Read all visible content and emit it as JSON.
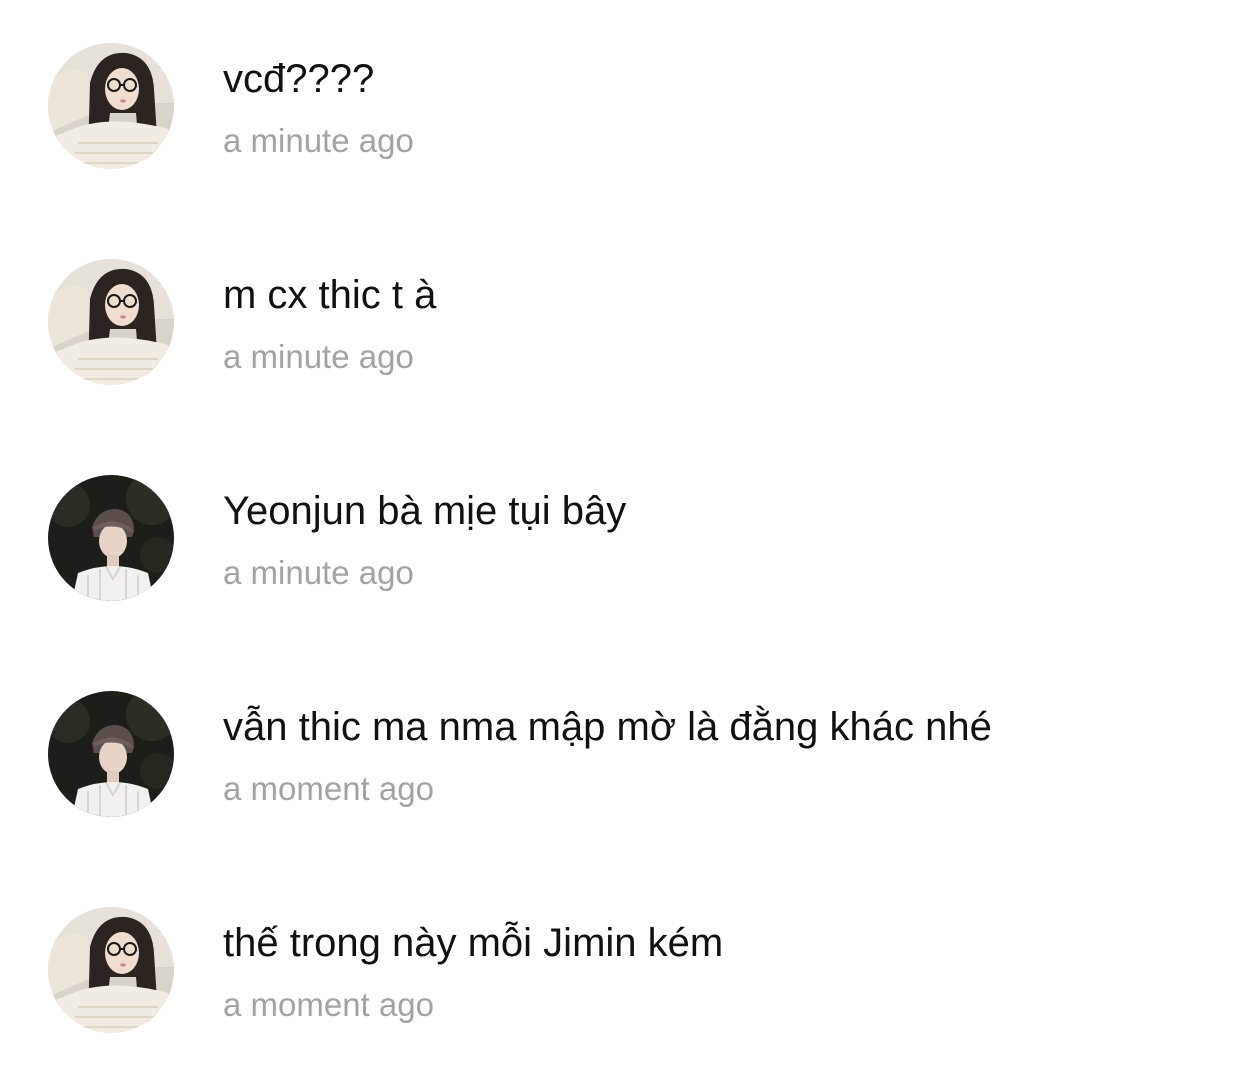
{
  "comments": [
    {
      "avatar": "girl-glasses-avatar",
      "text": "vcđ????",
      "time": "a minute ago"
    },
    {
      "avatar": "girl-glasses-avatar",
      "text": "m cx thic t à",
      "time": "a minute ago"
    },
    {
      "avatar": "boy-dark-avatar",
      "text": "Yeonjun bà mịe tụi bây",
      "time": "a minute ago"
    },
    {
      "avatar": "boy-dark-avatar",
      "text": "vẫn thic ma nma mập mờ là đằng khác nhé",
      "time": "a moment ago"
    },
    {
      "avatar": "girl-glasses-avatar",
      "text": "thế trong này mỗi Jimin kém",
      "time": "a moment ago"
    }
  ],
  "colors": {
    "text": "#111111",
    "timestamp": "#a3a3a3",
    "background": "#ffffff"
  }
}
